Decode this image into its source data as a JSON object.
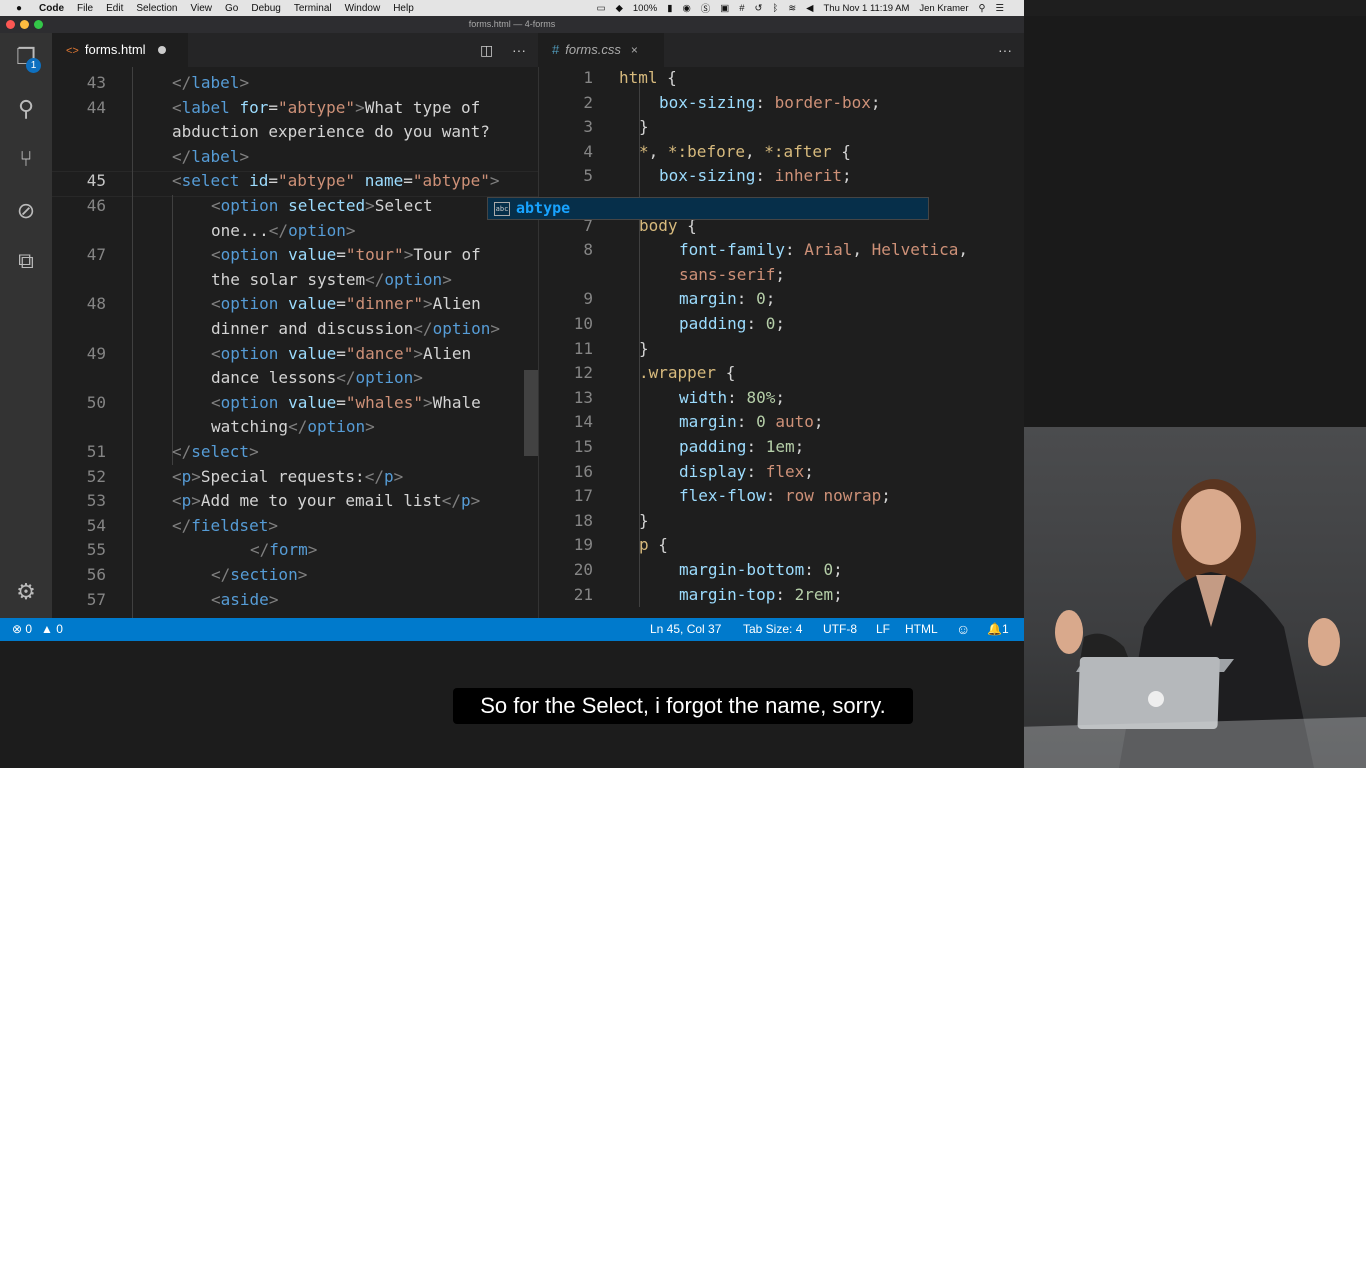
{
  "menubar": {
    "apple": "",
    "items": [
      "Code",
      "File",
      "Edit",
      "Selection",
      "View",
      "Go",
      "Debug",
      "Terminal",
      "Window",
      "Help"
    ],
    "battery": "100%",
    "clock": "Thu Nov 1  11:19 AM",
    "user": "Jen Kramer"
  },
  "window": {
    "title": "forms.html — 4-forms"
  },
  "activity": {
    "explorer_badge": "1"
  },
  "left_editor": {
    "tab_label": "forms.html",
    "action_more": "···",
    "lines": [
      {
        "n": "43",
        "segments": [
          [
            "br",
            "</"
          ],
          [
            "tag",
            "label"
          ],
          [
            "br",
            ">"
          ]
        ],
        "indent": 120
      },
      {
        "n": "44",
        "segments": [
          [
            "br",
            "<"
          ],
          [
            "tag",
            "label"
          ],
          [
            "text",
            " "
          ],
          [
            "attr",
            "for"
          ],
          [
            "text",
            "="
          ],
          [
            "str",
            "\"abtype\""
          ],
          [
            "br",
            ">"
          ],
          [
            "text",
            "What type of"
          ]
        ],
        "indent": 120
      },
      {
        "n": "",
        "segments": [
          [
            "text",
            "abduction experience do you want?"
          ]
        ],
        "indent": 120
      },
      {
        "n": "",
        "segments": [
          [
            "br",
            "</"
          ],
          [
            "tag",
            "label"
          ],
          [
            "br",
            ">"
          ]
        ],
        "indent": 120
      },
      {
        "n": "45",
        "segments": [
          [
            "br",
            "<"
          ],
          [
            "tag",
            "select"
          ],
          [
            "text",
            " "
          ],
          [
            "attr",
            "id"
          ],
          [
            "text",
            "="
          ],
          [
            "str",
            "\"abtype\""
          ],
          [
            "text",
            " "
          ],
          [
            "attr",
            "name"
          ],
          [
            "text",
            "="
          ],
          [
            "str",
            "\"abtype\""
          ],
          [
            "br",
            ">"
          ]
        ],
        "indent": 120,
        "active": true
      },
      {
        "n": "46",
        "segments": [
          [
            "br",
            "<"
          ],
          [
            "tag",
            "option"
          ],
          [
            "text",
            " "
          ],
          [
            "attr",
            "selected"
          ],
          [
            "br",
            ">"
          ],
          [
            "text",
            "Select"
          ]
        ],
        "indent": 159
      },
      {
        "n": "",
        "segments": [
          [
            "text",
            "one..."
          ],
          [
            "br",
            "</"
          ],
          [
            "tag",
            "option"
          ],
          [
            "br",
            ">"
          ]
        ],
        "indent": 159
      },
      {
        "n": "47",
        "segments": [
          [
            "br",
            "<"
          ],
          [
            "tag",
            "option"
          ],
          [
            "text",
            " "
          ],
          [
            "attr",
            "value"
          ],
          [
            "text",
            "="
          ],
          [
            "str",
            "\"tour\""
          ],
          [
            "br",
            ">"
          ],
          [
            "text",
            "Tour of"
          ]
        ],
        "indent": 159
      },
      {
        "n": "",
        "segments": [
          [
            "text",
            "the solar system"
          ],
          [
            "br",
            "</"
          ],
          [
            "tag",
            "option"
          ],
          [
            "br",
            ">"
          ]
        ],
        "indent": 159
      },
      {
        "n": "48",
        "segments": [
          [
            "br",
            "<"
          ],
          [
            "tag",
            "option"
          ],
          [
            "text",
            " "
          ],
          [
            "attr",
            "value"
          ],
          [
            "text",
            "="
          ],
          [
            "str",
            "\"dinner\""
          ],
          [
            "br",
            ">"
          ],
          [
            "text",
            "Alien"
          ]
        ],
        "indent": 159
      },
      {
        "n": "",
        "segments": [
          [
            "text",
            "dinner and discussion"
          ],
          [
            "br",
            "</"
          ],
          [
            "tag",
            "option"
          ],
          [
            "br",
            ">"
          ]
        ],
        "indent": 159
      },
      {
        "n": "49",
        "segments": [
          [
            "br",
            "<"
          ],
          [
            "tag",
            "option"
          ],
          [
            "text",
            " "
          ],
          [
            "attr",
            "value"
          ],
          [
            "text",
            "="
          ],
          [
            "str",
            "\"dance\""
          ],
          [
            "br",
            ">"
          ],
          [
            "text",
            "Alien"
          ]
        ],
        "indent": 159
      },
      {
        "n": "",
        "segments": [
          [
            "text",
            "dance lessons"
          ],
          [
            "br",
            "</"
          ],
          [
            "tag",
            "option"
          ],
          [
            "br",
            ">"
          ]
        ],
        "indent": 159
      },
      {
        "n": "50",
        "segments": [
          [
            "br",
            "<"
          ],
          [
            "tag",
            "option"
          ],
          [
            "text",
            " "
          ],
          [
            "attr",
            "value"
          ],
          [
            "text",
            "="
          ],
          [
            "str",
            "\"whales\""
          ],
          [
            "br",
            ">"
          ],
          [
            "text",
            "Whale"
          ]
        ],
        "indent": 159
      },
      {
        "n": "",
        "segments": [
          [
            "text",
            "watching"
          ],
          [
            "br",
            "</"
          ],
          [
            "tag",
            "option"
          ],
          [
            "br",
            ">"
          ]
        ],
        "indent": 159
      },
      {
        "n": "51",
        "segments": [
          [
            "br",
            "</"
          ],
          [
            "tag",
            "select"
          ],
          [
            "br",
            ">"
          ]
        ],
        "indent": 120
      },
      {
        "n": "52",
        "segments": [
          [
            "br",
            "<"
          ],
          [
            "tag",
            "p"
          ],
          [
            "br",
            ">"
          ],
          [
            "text",
            "Special requests:"
          ],
          [
            "br",
            "</"
          ],
          [
            "tag",
            "p"
          ],
          [
            "br",
            ">"
          ]
        ],
        "indent": 120
      },
      {
        "n": "53",
        "segments": [
          [
            "br",
            "<"
          ],
          [
            "tag",
            "p"
          ],
          [
            "br",
            ">"
          ],
          [
            "text",
            "Add me to your email list"
          ],
          [
            "br",
            "</"
          ],
          [
            "tag",
            "p"
          ],
          [
            "br",
            ">"
          ]
        ],
        "indent": 120
      },
      {
        "n": "54",
        "segments": [
          [
            "br",
            "</"
          ],
          [
            "tag",
            "fieldset"
          ],
          [
            "br",
            ">"
          ]
        ],
        "indent": 120
      },
      {
        "n": "55",
        "segments": [
          [
            "br",
            "</"
          ],
          [
            "tag",
            "form"
          ],
          [
            "br",
            ">"
          ]
        ],
        "indent": 198
      },
      {
        "n": "56",
        "segments": [
          [
            "br",
            "</"
          ],
          [
            "tag",
            "section"
          ],
          [
            "br",
            ">"
          ]
        ],
        "indent": 159
      },
      {
        "n": "57",
        "segments": [
          [
            "br",
            "<"
          ],
          [
            "tag",
            "aside"
          ],
          [
            "br",
            ">"
          ]
        ],
        "indent": 159
      }
    ],
    "autocomplete": {
      "icon": "abc",
      "suggestion": "abtype"
    }
  },
  "right_editor": {
    "tab_label": "forms.css",
    "tab_close": "×",
    "action_more": "···",
    "lines": [
      {
        "n": "1",
        "segments": [
          [
            "sel",
            "html"
          ],
          [
            "p",
            " {"
          ]
        ],
        "indent": 80
      },
      {
        "n": "2",
        "segments": [
          [
            "prop",
            "box-sizing"
          ],
          [
            "p",
            ": "
          ],
          [
            "val",
            "border-box"
          ],
          [
            "p",
            ";"
          ]
        ],
        "indent": 120
      },
      {
        "n": "3",
        "segments": [
          [
            "p",
            "}"
          ]
        ],
        "indent": 100
      },
      {
        "n": "4",
        "segments": [
          [
            "sel",
            "*"
          ],
          [
            "p",
            ", "
          ],
          [
            "sel",
            "*:before"
          ],
          [
            "p",
            ", "
          ],
          [
            "sel",
            "*:after"
          ],
          [
            "p",
            " {"
          ]
        ],
        "indent": 100
      },
      {
        "n": "5",
        "segments": [
          [
            "prop",
            "box-sizing"
          ],
          [
            "p",
            ": "
          ],
          [
            "val",
            "inherit"
          ],
          [
            "p",
            ";"
          ]
        ],
        "indent": 120
      },
      {
        "n": "",
        "segments": [],
        "indent": 100
      },
      {
        "n": "7",
        "segments": [
          [
            "sel",
            "body"
          ],
          [
            "p",
            " {"
          ]
        ],
        "indent": 100
      },
      {
        "n": "8",
        "segments": [
          [
            "prop",
            "font-family"
          ],
          [
            "p",
            ": "
          ],
          [
            "val",
            "Arial"
          ],
          [
            "p",
            ", "
          ],
          [
            "val",
            "Helvetica"
          ],
          [
            "p",
            ","
          ]
        ],
        "indent": 140
      },
      {
        "n": "",
        "segments": [
          [
            "val",
            "sans-serif"
          ],
          [
            "p",
            ";"
          ]
        ],
        "indent": 140
      },
      {
        "n": "9",
        "segments": [
          [
            "prop",
            "margin"
          ],
          [
            "p",
            ": "
          ],
          [
            "num",
            "0"
          ],
          [
            "p",
            ";"
          ]
        ],
        "indent": 140
      },
      {
        "n": "10",
        "segments": [
          [
            "prop",
            "padding"
          ],
          [
            "p",
            ": "
          ],
          [
            "num",
            "0"
          ],
          [
            "p",
            ";"
          ]
        ],
        "indent": 140
      },
      {
        "n": "11",
        "segments": [
          [
            "p",
            "}"
          ]
        ],
        "indent": 100
      },
      {
        "n": "12",
        "segments": [
          [
            "sel",
            ".wrapper"
          ],
          [
            "p",
            " {"
          ]
        ],
        "indent": 100
      },
      {
        "n": "13",
        "segments": [
          [
            "prop",
            "width"
          ],
          [
            "p",
            ": "
          ],
          [
            "num",
            "80%"
          ],
          [
            "p",
            ";"
          ]
        ],
        "indent": 140
      },
      {
        "n": "14",
        "segments": [
          [
            "prop",
            "margin"
          ],
          [
            "p",
            ": "
          ],
          [
            "num",
            "0"
          ],
          [
            "p",
            " "
          ],
          [
            "val",
            "auto"
          ],
          [
            "p",
            ";"
          ]
        ],
        "indent": 140
      },
      {
        "n": "15",
        "segments": [
          [
            "prop",
            "padding"
          ],
          [
            "p",
            ": "
          ],
          [
            "num",
            "1em"
          ],
          [
            "p",
            ";"
          ]
        ],
        "indent": 140
      },
      {
        "n": "16",
        "segments": [
          [
            "prop",
            "display"
          ],
          [
            "p",
            ": "
          ],
          [
            "val",
            "flex"
          ],
          [
            "p",
            ";"
          ]
        ],
        "indent": 140
      },
      {
        "n": "17",
        "segments": [
          [
            "prop",
            "flex-flow"
          ],
          [
            "p",
            ": "
          ],
          [
            "val",
            "row nowrap"
          ],
          [
            "p",
            ";"
          ]
        ],
        "indent": 140
      },
      {
        "n": "18",
        "segments": [
          [
            "p",
            "}"
          ]
        ],
        "indent": 100
      },
      {
        "n": "19",
        "segments": [
          [
            "sel",
            "p"
          ],
          [
            "p",
            " {"
          ]
        ],
        "indent": 100
      },
      {
        "n": "20",
        "segments": [
          [
            "prop",
            "margin-bottom"
          ],
          [
            "p",
            ": "
          ],
          [
            "num",
            "0"
          ],
          [
            "p",
            ";"
          ]
        ],
        "indent": 140
      },
      {
        "n": "21",
        "segments": [
          [
            "prop",
            "margin-top"
          ],
          [
            "p",
            ": "
          ],
          [
            "num",
            "2rem"
          ],
          [
            "p",
            ";"
          ]
        ],
        "indent": 140
      }
    ]
  },
  "statusbar": {
    "errors": "0",
    "warnings": "0",
    "position": "Ln 45, Col 37",
    "tab_size": "Tab Size: 4",
    "encoding": "UTF-8",
    "eol": "LF",
    "language": "HTML",
    "notifications": "1"
  },
  "subtitle": "So for the Select, i forgot the name, sorry.",
  "colors": {
    "statusbar": "#007acc",
    "editor_bg": "#1e1e1e",
    "activity_bg": "#333333"
  }
}
